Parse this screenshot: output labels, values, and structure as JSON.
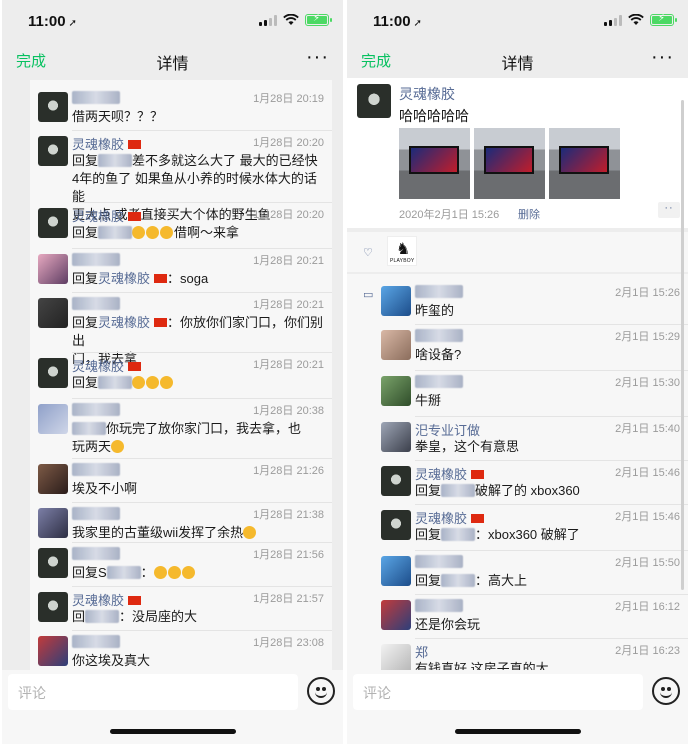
{
  "left": {
    "status": {
      "time": "11:00"
    },
    "nav": {
      "done": "完成",
      "title": "详情",
      "more": "···"
    },
    "comments": [
      {
        "avatar": "skull",
        "name": "",
        "time": "1月28日 20:19",
        "lines": [
          [
            "借两天呗？？？"
          ]
        ]
      },
      {
        "avatar": "skull",
        "name": "灵魂橡胶",
        "flag": true,
        "time": "1月28日 20:20",
        "lines": [
          [
            "回复",
            "@blur",
            "差不多就这么大了 最大的已经快"
          ],
          [
            "4年的鱼了 如果鱼从小养的时候水体大的话 能"
          ],
          [
            "更大点 或者直接买大个体的野生鱼"
          ]
        ]
      },
      {
        "avatar": "skull",
        "name": "灵魂橡胶",
        "flag": true,
        "time": "1月28日 20:20",
        "lines": [
          [
            "回复",
            "@blur",
            "@emoji3",
            "借啊～来拿"
          ]
        ]
      },
      {
        "avatar": "anime",
        "name": "",
        "time": "1月28日 20:21",
        "lines": [
          [
            "回复",
            "@name:灵魂橡胶",
            "@flag",
            "：soga"
          ]
        ]
      },
      {
        "avatar": "dark",
        "name": "",
        "time": "1月28日 20:21",
        "lines": [
          [
            "回复",
            "@name:灵魂橡胶",
            "@flag",
            "：你放你们家门口，你们别出"
          ],
          [
            "门，我去拿"
          ]
        ]
      },
      {
        "avatar": "skull",
        "name": "灵魂橡胶",
        "flag": true,
        "time": "1月28日 20:21",
        "lines": [
          [
            "回复",
            "@blur",
            "@emoji3"
          ]
        ]
      },
      {
        "avatar": "blur",
        "name": "",
        "time": "1月28日 20:38",
        "lines": [
          [
            "@blur",
            "你玩完了放你家门口，我去拿，也"
          ],
          [
            "玩两天",
            "@emoji1"
          ]
        ]
      },
      {
        "avatar": "girl",
        "name": "",
        "time": "1月28日 21:26",
        "lines": [
          [
            "埃及不小啊"
          ]
        ]
      },
      {
        "avatar": "car",
        "name": "",
        "time": "1月28日 21:38",
        "lines": [
          [
            "我家里的古董级wii发挥了余热",
            "@emoji1"
          ]
        ]
      },
      {
        "avatar": "skull",
        "name": "",
        "time": "1月28日 21:56",
        "lines": [
          [
            "回复S",
            "@blur",
            "：",
            "@emoji3"
          ]
        ]
      },
      {
        "avatar": "skull",
        "name": "灵魂橡胶",
        "flag": true,
        "time": "1月28日 21:57",
        "lines": [
          [
            "回",
            "@blur",
            "：没局座的大"
          ]
        ]
      },
      {
        "avatar": "red",
        "name": "",
        "time": "1月28日 23:08",
        "lines": [
          [
            "你这埃及真大"
          ]
        ]
      }
    ],
    "input": {
      "placeholder": "评论"
    }
  },
  "right": {
    "status": {
      "time": "11:00"
    },
    "nav": {
      "done": "完成",
      "title": "详情",
      "more": "···"
    },
    "post": {
      "name": "灵魂橡胶",
      "text": "哈哈哈哈哈",
      "time": "2020年2月1日 15:26",
      "delete": "删除",
      "photo_count": 3
    },
    "likes": {
      "avatar_label": "PLAYBOY"
    },
    "comments": [
      {
        "avatar": "blue",
        "name": "",
        "time": "2月1日 15:26",
        "lines": [
          [
            "昨玺的"
          ]
        ]
      },
      {
        "avatar": "skin",
        "name": "",
        "time": "2月1日 15:29",
        "lines": [
          [
            "啥设备?"
          ]
        ]
      },
      {
        "avatar": "green",
        "name": "",
        "time": "2月1日 15:30",
        "lines": [
          [
            "牛掰"
          ]
        ]
      },
      {
        "avatar": "person",
        "name": "汜专业订做",
        "time": "2月1日 15:40",
        "lines": [
          [
            "拳皇，这个有意思"
          ]
        ]
      },
      {
        "avatar": "skull",
        "name": "灵魂橡胶",
        "flag": true,
        "time": "2月1日 15:46",
        "lines": [
          [
            "回复",
            "@blur",
            "破解了的 xbox360"
          ]
        ]
      },
      {
        "avatar": "skull",
        "name": "灵魂橡胶",
        "flag": true,
        "time": "2月1日 15:46",
        "lines": [
          [
            "回复",
            "@blur",
            "：xbox360 破解了"
          ]
        ]
      },
      {
        "avatar": "blue",
        "name": "",
        "time": "2月1日 15:50",
        "lines": [
          [
            "回复",
            "@blur",
            "：高大上"
          ]
        ]
      },
      {
        "avatar": "red",
        "name": "",
        "time": "2月1日 16:12",
        "lines": [
          [
            "还是你会玩"
          ]
        ]
      },
      {
        "avatar": "white",
        "name": "郑",
        "time": "2月1日 16:23",
        "lines": [
          [
            "有钱真好 这房子真的大"
          ]
        ]
      }
    ],
    "input": {
      "placeholder": "评论"
    }
  },
  "colors": {
    "accent": "#07c160",
    "link": "#576b95"
  }
}
